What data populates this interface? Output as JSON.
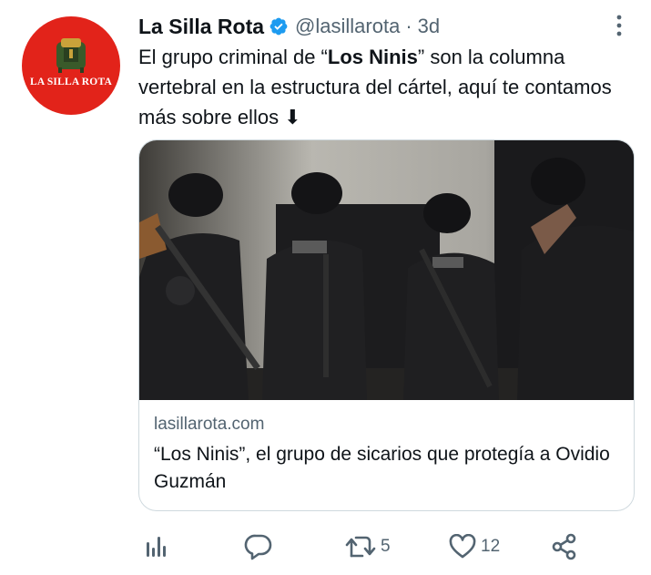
{
  "tweet": {
    "author_name": "La Silla Rota",
    "handle": "@lasillarota",
    "separator": "·",
    "time": "3d",
    "avatar_text": "LA SILLA ROTA",
    "text_before": "El grupo criminal de “",
    "text_bold": "Los Ninis",
    "text_after": "” son la columna vertebral en la estructura del cártel, aquí te contamos más sobre ellos ⬇"
  },
  "card": {
    "image_icon": "armed-men-photo",
    "domain": "lasillarota.com",
    "title": "“Los Ninis”, el grupo de sicarios que protegía a Ovidio Guzmán"
  },
  "actions": {
    "views_icon": "bar-chart-icon",
    "reply_icon": "reply-icon",
    "retweet_icon": "retweet-icon",
    "retweet_count": "5",
    "like_icon": "heart-icon",
    "like_count": "12",
    "share_icon": "share-icon"
  },
  "colors": {
    "accent": "#1d9bf0",
    "avatar_bg": "#e2231a",
    "secondary_text": "#536471",
    "border": "#cfd9de"
  }
}
